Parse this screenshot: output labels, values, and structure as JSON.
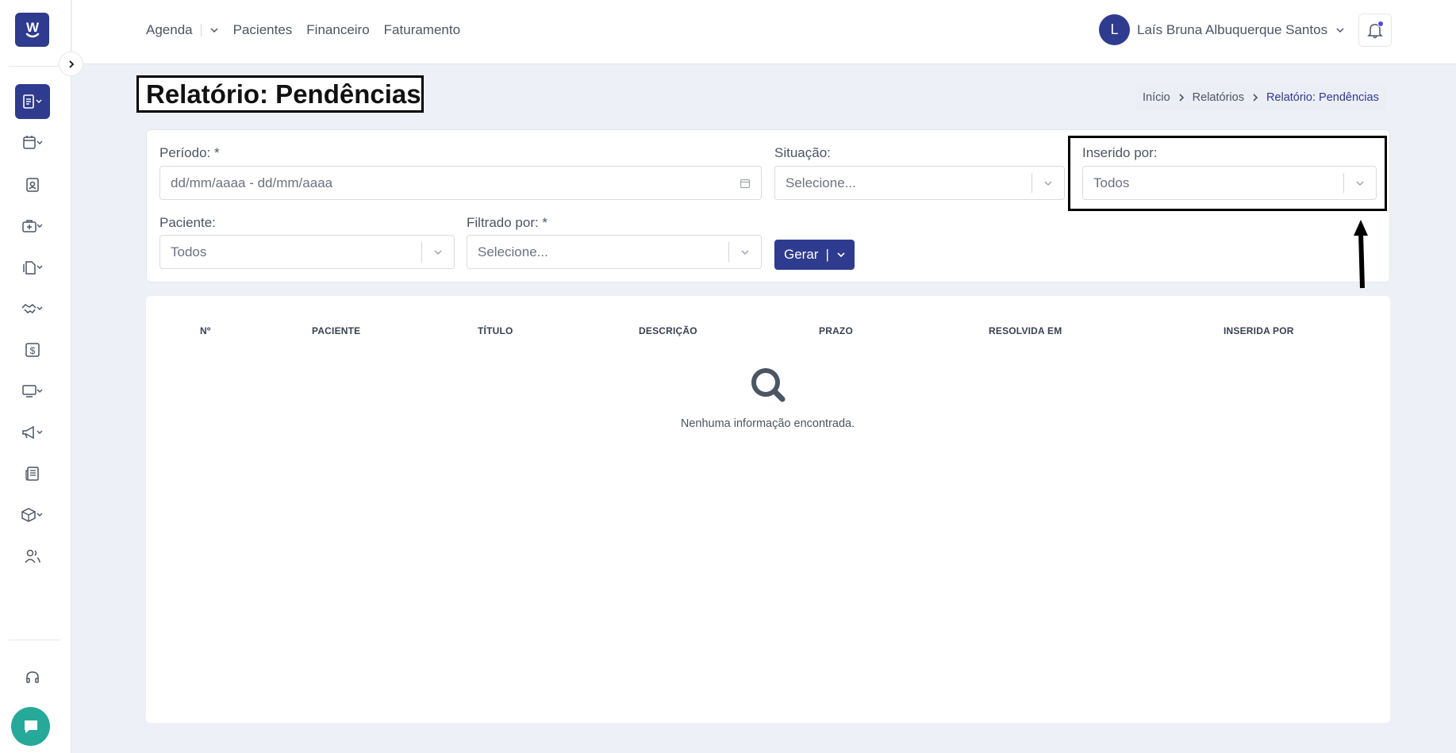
{
  "colors": {
    "brand": "#2f3b8e",
    "chat": "#27a99a",
    "notification_dot": "#4f46e5"
  },
  "logo": {
    "letter": "W",
    "icon": "logo-smile-icon"
  },
  "sidebar": {
    "items": [
      {
        "icon": "report-icon",
        "active": true,
        "has_dropdown": true
      },
      {
        "icon": "calendar-icon",
        "has_dropdown": true
      },
      {
        "icon": "patient-badge-icon",
        "has_dropdown": false
      },
      {
        "icon": "medical-bag-icon",
        "has_dropdown": true
      },
      {
        "icon": "documents-icon",
        "has_dropdown": true
      },
      {
        "icon": "handshake-icon",
        "has_dropdown": true
      },
      {
        "icon": "dollar-icon",
        "has_dropdown": false
      },
      {
        "icon": "monitor-icon",
        "has_dropdown": true
      },
      {
        "icon": "megaphone-icon",
        "has_dropdown": true
      },
      {
        "icon": "newspaper-icon",
        "has_dropdown": false
      },
      {
        "icon": "box-icon",
        "has_dropdown": true
      },
      {
        "icon": "users-icon",
        "has_dropdown": false
      }
    ],
    "support_icon": "headset-icon",
    "chat_icon": "chat-icon"
  },
  "topnav": {
    "agenda": "Agenda",
    "pacientes": "Pacientes",
    "financeiro": "Financeiro",
    "faturamento": "Faturamento"
  },
  "user": {
    "initial": "L",
    "name": "Laís Bruna Albuquerque Santos"
  },
  "page": {
    "title": "Relatório: Pendências",
    "breadcrumb": [
      "Início",
      "Relatórios",
      "Relatório: Pendências"
    ]
  },
  "filters": {
    "periodo": {
      "label": "Período: *",
      "placeholder": "dd/mm/aaaa - dd/mm/aaaa"
    },
    "situacao": {
      "label": "Situação:",
      "value": "Selecione..."
    },
    "inserido_por": {
      "label": "Inserido por:",
      "value": "Todos"
    },
    "paciente": {
      "label": "Paciente:",
      "value": "Todos"
    },
    "filtrado_por": {
      "label": "Filtrado por: *",
      "value": "Selecione..."
    },
    "gerar_label": "Gerar"
  },
  "table": {
    "columns": [
      "Nº",
      "PACIENTE",
      "TÍTULO",
      "DESCRIÇÃO",
      "PRAZO",
      "RESOLVIDA EM",
      "INSERIDA POR"
    ],
    "empty_message": "Nenhuma informação encontrada."
  }
}
